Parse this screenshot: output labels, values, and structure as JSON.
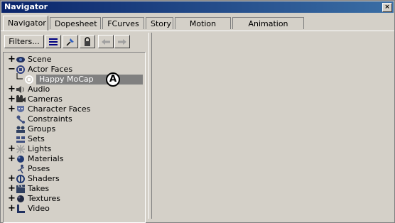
{
  "window": {
    "title": "Navigator",
    "close_icon": "close-icon"
  },
  "tabs": [
    {
      "label": "Navigator",
      "active": true
    },
    {
      "label": "Dopesheet"
    },
    {
      "label": "FCurves"
    },
    {
      "label": "Story"
    },
    {
      "label": "Motion Blend"
    },
    {
      "label": "Animation Trigger"
    }
  ],
  "toolbar": {
    "filters_label": "Filters...",
    "icons": [
      "list-view-icon",
      "pin-icon",
      "lock-icon",
      "back-arrow-icon",
      "forward-arrow-icon"
    ]
  },
  "tree": [
    {
      "label": "Scene",
      "expander": "+",
      "icon": "scene-icon"
    },
    {
      "label": "Actor Faces",
      "expander": "−",
      "icon": "actor-face-icon"
    },
    {
      "label": "Happy MoCap",
      "expander": "",
      "icon": "actor-face-icon",
      "child": true,
      "selected": true,
      "callout": "A"
    },
    {
      "label": "Audio",
      "expander": "+",
      "icon": "audio-icon"
    },
    {
      "label": "Cameras",
      "expander": "+",
      "icon": "camera-icon"
    },
    {
      "label": "Character Faces",
      "expander": "+",
      "icon": "character-face-icon"
    },
    {
      "label": "Constraints",
      "expander": "",
      "icon": "constraint-icon"
    },
    {
      "label": "Groups",
      "expander": "",
      "icon": "group-icon"
    },
    {
      "label": "Sets",
      "expander": "",
      "icon": "set-icon"
    },
    {
      "label": "Lights",
      "expander": "+",
      "icon": "light-icon"
    },
    {
      "label": "Materials",
      "expander": "+",
      "icon": "material-icon"
    },
    {
      "label": "Poses",
      "expander": "",
      "icon": "pose-icon"
    },
    {
      "label": "Shaders",
      "expander": "+",
      "icon": "shader-icon"
    },
    {
      "label": "Takes",
      "expander": "+",
      "icon": "take-icon"
    },
    {
      "label": "Textures",
      "expander": "+",
      "icon": "texture-icon"
    },
    {
      "label": "Video",
      "expander": "+",
      "icon": "video-icon"
    }
  ]
}
